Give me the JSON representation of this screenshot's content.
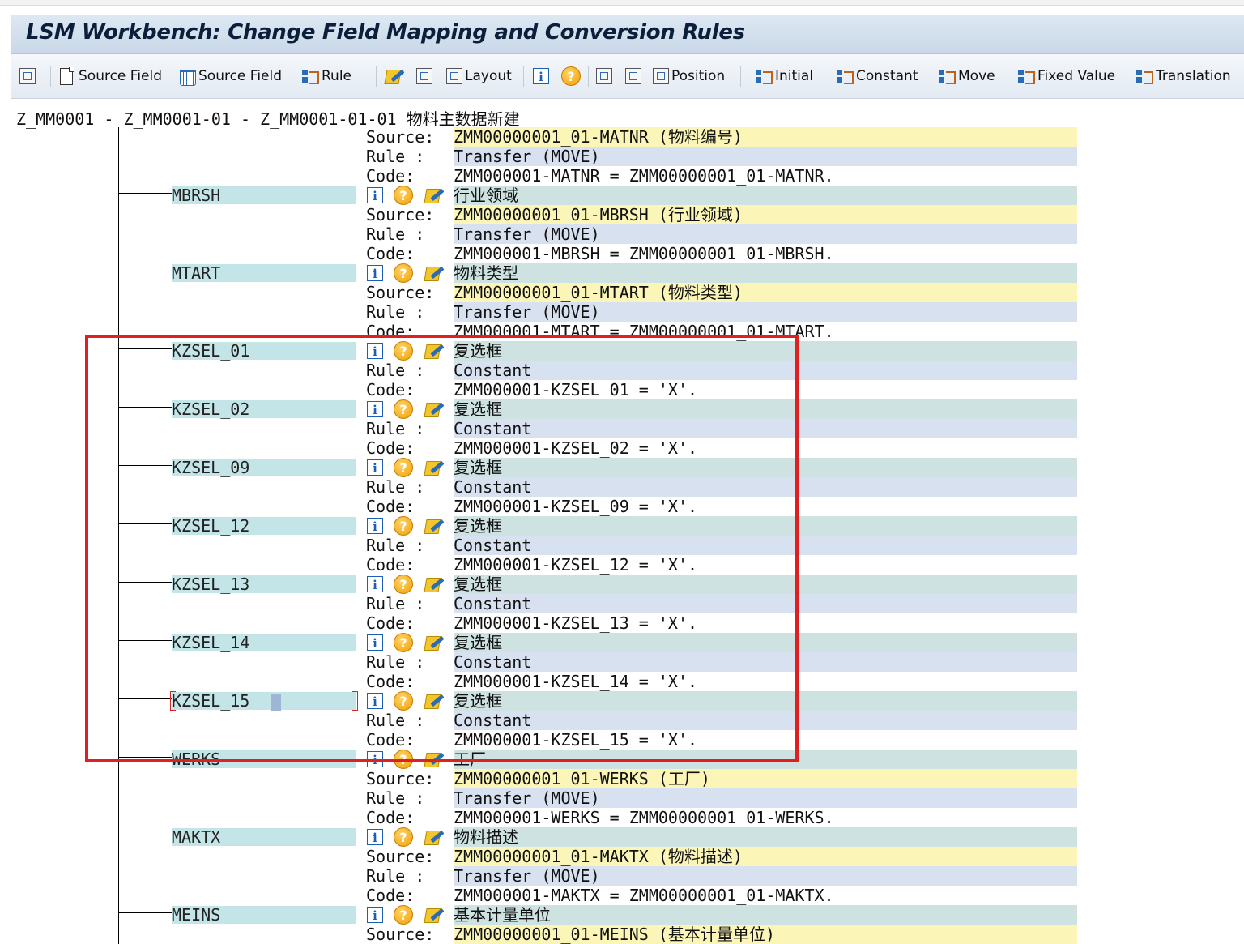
{
  "window": {
    "title": "LSM Workbench: Change Field Mapping and Conversion Rules"
  },
  "toolbar": {
    "items": [
      {
        "icon": "object-icon",
        "label": ""
      },
      {
        "icon": "new-document-icon",
        "label": "Source Field"
      },
      {
        "icon": "trash-icon",
        "label": "Source Field"
      },
      {
        "icon": "rule-icon",
        "label": "Rule"
      },
      {
        "icon": "edit-icon",
        "label": ""
      },
      {
        "icon": "hierarchy-icon",
        "label": ""
      },
      {
        "icon": "layout-icon",
        "label": "Layout"
      },
      {
        "icon": "info-icon",
        "label": ""
      },
      {
        "icon": "help-icon",
        "label": ""
      },
      {
        "icon": "expand-icon",
        "label": ""
      },
      {
        "icon": "collapse-icon",
        "label": ""
      },
      {
        "icon": "position-icon",
        "label": "Position"
      },
      {
        "icon": "rule-icon",
        "label": "Initial"
      },
      {
        "icon": "rule-icon",
        "label": "Constant"
      },
      {
        "icon": "rule-icon",
        "label": "Move"
      },
      {
        "icon": "rule-icon",
        "label": "Fixed Value"
      },
      {
        "icon": "rule-icon",
        "label": "Translation"
      }
    ]
  },
  "header_path": "Z_MM0001 - Z_MM0001-01 - Z_MM0001-01-01 物料主数据新建",
  "labels": {
    "source": "Source:",
    "rule": "Rule :",
    "code": "Code:"
  },
  "top_block": {
    "source": "ZMM00000001_01-MATNR (物料编号)",
    "rule": "Transfer (MOVE)",
    "code": "ZMM000001-MATNR = ZMM00000001_01-MATNR."
  },
  "fields": [
    {
      "name": "MBRSH",
      "desc": "行业领域",
      "source": "ZMM00000001_01-MBRSH (行业领域)",
      "rule": "Transfer (MOVE)",
      "code": "ZMM000001-MBRSH = ZMM00000001_01-MBRSH."
    },
    {
      "name": "MTART",
      "desc": "物料类型",
      "source": "ZMM00000001_01-MTART (物料类型)",
      "rule": "Transfer (MOVE)",
      "code": "ZMM000001-MTART = ZMM00000001_01-MTART."
    },
    {
      "name": "KZSEL_01",
      "desc": "复选框",
      "rule": "Constant",
      "code": "ZMM000001-KZSEL_01 = 'X'."
    },
    {
      "name": "KZSEL_02",
      "desc": "复选框",
      "rule": "Constant",
      "code": "ZMM000001-KZSEL_02 = 'X'."
    },
    {
      "name": "KZSEL_09",
      "desc": "复选框",
      "rule": "Constant",
      "code": "ZMM000001-KZSEL_09 = 'X'."
    },
    {
      "name": "KZSEL_12",
      "desc": "复选框",
      "rule": "Constant",
      "code": "ZMM000001-KZSEL_12 = 'X'."
    },
    {
      "name": "KZSEL_13",
      "desc": "复选框",
      "rule": "Constant",
      "code": "ZMM000001-KZSEL_13 = 'X'."
    },
    {
      "name": "KZSEL_14",
      "desc": "复选框",
      "rule": "Constant",
      "code": "ZMM000001-KZSEL_14 = 'X'."
    },
    {
      "name": "KZSEL_15",
      "desc": "复选框",
      "rule": "Constant",
      "code": "ZMM000001-KZSEL_15 = 'X'.",
      "focused": true
    },
    {
      "name": "WERKS",
      "desc": "工厂",
      "source": "ZMM00000001_01-WERKS (工厂)",
      "rule": "Transfer (MOVE)",
      "code": "ZMM000001-WERKS = ZMM00000001_01-WERKS."
    },
    {
      "name": "MAKTX",
      "desc": "物料描述",
      "source": "ZMM00000001_01-MAKTX (物料描述)",
      "rule": "Transfer (MOVE)",
      "code": "ZMM000001-MAKTX = ZMM00000001_01-MAKTX."
    },
    {
      "name": "MEINS",
      "desc": "基本计量单位",
      "source": "ZMM00000001_01-MEINS (基本计量单位)"
    }
  ],
  "colors": {
    "highlight_box": "#e02020",
    "source_band": "#fbf6b8",
    "rule_band": "#d7e1ef",
    "node_bg": "#c4e5e7"
  }
}
